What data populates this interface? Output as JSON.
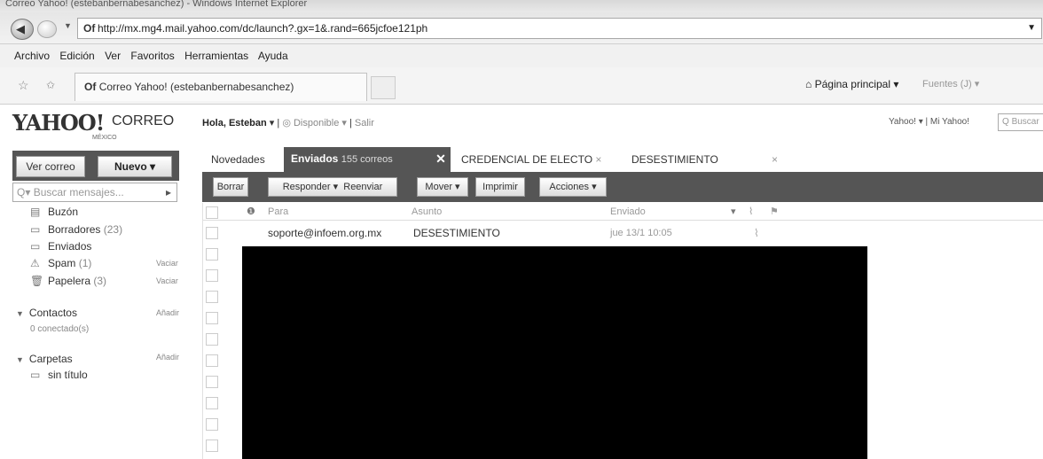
{
  "window": {
    "title": "Correo Yahoo! (estebanbernabesanchez) - Windows Internet Explorer"
  },
  "address": {
    "url": "http://mx.mg4.mail.yahoo.com/dc/launch?.gx=1&.rand=665jcfoe121ph"
  },
  "menu": [
    "Archivo",
    "Edición",
    "Ver",
    "Favoritos",
    "Herramientas",
    "Ayuda"
  ],
  "tab": {
    "title": "Correo Yahoo! (estebanbernabesanchez)"
  },
  "commandbar": {
    "home": "Página principal",
    "feeds": "Fuentes (J)"
  },
  "header": {
    "logo": "YAHOO!",
    "product": "CORREO",
    "region": "MÉXICO",
    "greeting": "Hola, Esteban",
    "status": "Disponible",
    "signout": "Salir",
    "links": "Yahoo! ▾ | Mi Yahoo!",
    "search_placeholder": "Buscar"
  },
  "left": {
    "view_mail": "Ver correo",
    "new": "Nuevo",
    "search_placeholder": "Buscar mensajes...",
    "folders": [
      {
        "name": "Buzón",
        "count": ""
      },
      {
        "name": "Borradores",
        "count": "(23)"
      },
      {
        "name": "Enviados",
        "count": ""
      },
      {
        "name": "Spam",
        "count": "(1)",
        "action": "Vaciar"
      },
      {
        "name": "Papelera",
        "count": "(3)",
        "action": "Vaciar"
      }
    ],
    "contacts": {
      "label": "Contactos",
      "action": "Añadir",
      "sub": "0 conectado(s)"
    },
    "carpetas": {
      "label": "Carpetas",
      "action": "Añadir",
      "items": [
        "sin título"
      ]
    }
  },
  "tabs": [
    {
      "label": "Novedades"
    },
    {
      "label": "Enviados",
      "count": "155 correos",
      "active": true
    },
    {
      "label": "CREDENCIAL DE ELECTO"
    },
    {
      "label": "DESESTIMIENTO"
    }
  ],
  "toolbar": {
    "delete": "Borrar",
    "reply": "Responder",
    "forward": "Reenviar",
    "move": "Mover",
    "print": "Imprimir",
    "actions": "Acciones"
  },
  "table": {
    "headers": {
      "to": "Para",
      "subject": "Asunto",
      "sent": "Enviado"
    },
    "rows": [
      {
        "to": "soporte@infoem.org.mx",
        "subject": "DESESTIMIENTO",
        "sent": "jue 13/1 10:05"
      }
    ]
  }
}
